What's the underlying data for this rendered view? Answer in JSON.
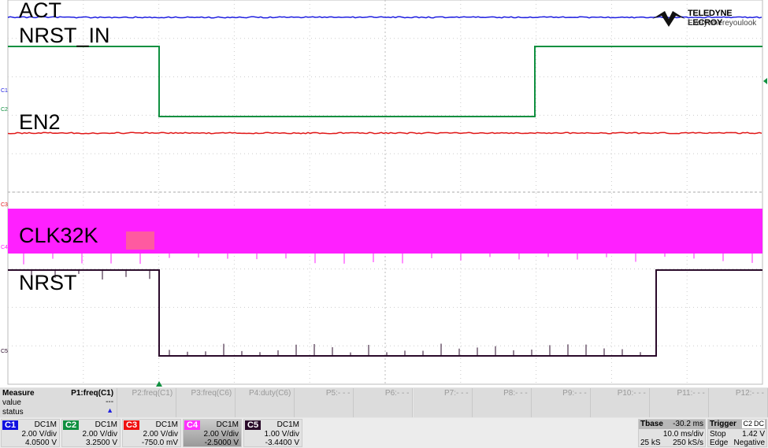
{
  "traces": [
    {
      "label": "ACT",
      "channel": "C1",
      "color": "#1f1fe0"
    },
    {
      "label": "NRST_IN",
      "channel": "C2",
      "color": "#109040"
    },
    {
      "label": "EN2",
      "channel": "C3",
      "color": "#e01818"
    },
    {
      "label": "CLK32K",
      "channel": "C4",
      "color": "#ff20ff"
    },
    {
      "label": "NRST",
      "channel": "C5",
      "color": "#2a0a2a"
    }
  ],
  "logo": {
    "brand": "TELEDYNE LECROY",
    "tagline": "Everywhereyoulook"
  },
  "measure": {
    "title": "Measure",
    "row_value": "value",
    "row_status": "status",
    "params": [
      {
        "name": "P1:freq(C1)",
        "value": "---",
        "status": "▲"
      },
      {
        "name": "P2:freq(C1)"
      },
      {
        "name": "P3:freq(C6)"
      },
      {
        "name": "P4:duty(C6)"
      },
      {
        "name": "P5:- - -"
      },
      {
        "name": "P6:- - -"
      },
      {
        "name": "P7:- - -"
      },
      {
        "name": "P8:- - -"
      },
      {
        "name": "P9:- - -"
      },
      {
        "name": "P10:- - -"
      },
      {
        "name": "P11:- - -"
      },
      {
        "name": "P12:- - -"
      }
    ]
  },
  "channels": [
    {
      "id": "C1",
      "coupling": "DC1M",
      "vdiv": "2.00 V/div",
      "offset": "4.0500 V",
      "color": "#1010e0"
    },
    {
      "id": "C2",
      "coupling": "DC1M",
      "vdiv": "2.00 V/div",
      "offset": "3.2500 V",
      "color": "#109040"
    },
    {
      "id": "C3",
      "coupling": "DC1M",
      "vdiv": "2.00 V/div",
      "offset": "-750.0 mV",
      "color": "#f01010"
    },
    {
      "id": "C4",
      "coupling": "DC1M",
      "vdiv": "2.00 V/div",
      "offset": "-2.5000 V",
      "color": "#ff30ff"
    },
    {
      "id": "C5",
      "coupling": "DC1M",
      "vdiv": "1.00 V/div",
      "offset": "-3.4400 V",
      "color": "#2a0a2a"
    }
  ],
  "timebase": {
    "title": "Tbase",
    "delay": "-30.2 ms",
    "tdiv": "10.0 ms/div",
    "samples": "25 kS",
    "rate": "250 kS/s"
  },
  "trigger": {
    "title": "Trigger",
    "source": "C2",
    "coupling": "DC",
    "mode": "Stop",
    "level": "1.42 V",
    "type": "Edge",
    "slope": "Negative"
  }
}
